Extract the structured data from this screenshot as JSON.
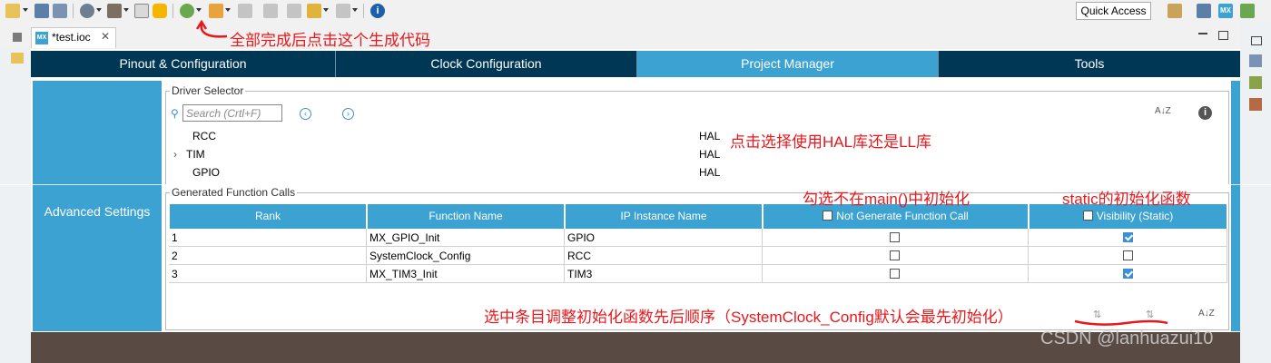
{
  "toolbar": {
    "quick_access": "Quick Access"
  },
  "tab": {
    "title": "*test.ioc",
    "mx_badge": "MX"
  },
  "nav_tabs": [
    {
      "label": "Pinout & Configuration"
    },
    {
      "label": "Clock Configuration"
    },
    {
      "label": "Project Manager"
    },
    {
      "label": "Tools"
    }
  ],
  "sidebar": {
    "advanced_settings": "Advanced Settings"
  },
  "driver_selector": {
    "legend": "Driver Selector",
    "search_placeholder": "Search (Crtl+F)",
    "rows": [
      {
        "name": "RCC",
        "driver": "HAL"
      },
      {
        "name": "TIM",
        "driver": "HAL"
      },
      {
        "name": "GPIO",
        "driver": "HAL"
      }
    ],
    "sort_icon_text": "A↓Z"
  },
  "generated_calls": {
    "legend": "Generated Function Calls",
    "headers": {
      "rank": "Rank",
      "function_name": "Function Name",
      "ip_instance": "IP Instance Name",
      "not_generate": "Not Generate Function Call",
      "visibility": "Visibility (Static)"
    },
    "rows": [
      {
        "rank": "1",
        "function": "MX_GPIO_Init",
        "ip": "GPIO",
        "not_generate": false,
        "static": true
      },
      {
        "rank": "2",
        "function": "SystemClock_Config",
        "ip": "RCC",
        "not_generate": false,
        "static": false
      },
      {
        "rank": "3",
        "function": "MX_TIM3_Init",
        "ip": "TIM3",
        "not_generate": false,
        "static": true
      }
    ]
  },
  "annotations": {
    "generate_code": "全部完成后点击这个生成代码",
    "hal_or_ll": "点击选择使用HAL库还是LL库",
    "not_in_main": "勾选不在main()中初始化",
    "static_init": "static的初始化函数",
    "order": "选中条目调整初始化函数先后顺序（SystemClock_Config默认会最先初始化）"
  },
  "watermark": "CSDN @lanhuazui10",
  "colors": {
    "nav_dark": "#003755",
    "accent_blue": "#3ca2d2",
    "annotation_red": "#e8181c"
  }
}
